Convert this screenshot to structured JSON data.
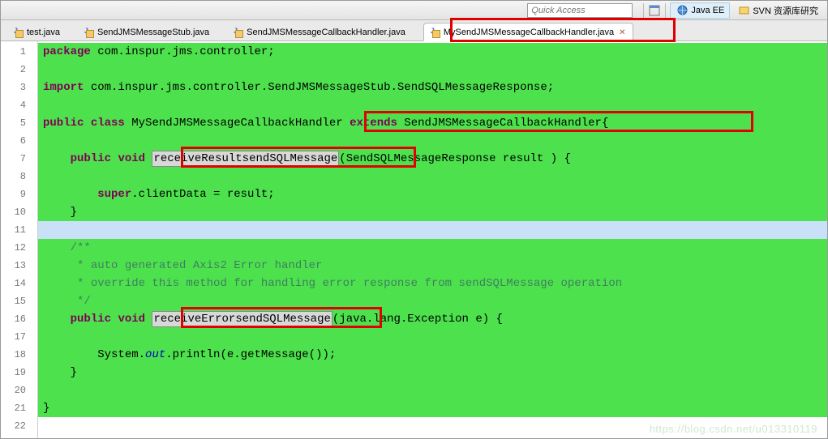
{
  "toolbar": {
    "quick_access_placeholder": "Quick Access",
    "perspectives": [
      {
        "label": "Java EE",
        "active": true
      },
      {
        "label": "SVN 资源库研究",
        "active": false
      }
    ]
  },
  "tabs": [
    {
      "label": "test.java",
      "active": false
    },
    {
      "label": "SendJMSMessageStub.java",
      "active": false
    },
    {
      "label": "SendJMSMessageCallbackHandler.java",
      "active": false
    },
    {
      "label": "MySendJMSMessageCallbackHandler.java",
      "active": true
    }
  ],
  "code_tokens": {
    "package": "package",
    "import": "import",
    "public": "public",
    "class": "class",
    "extends": "extends",
    "void": "void",
    "super": "super",
    "pkg_decl": " com.inspur.jms.controller;",
    "import_decl": " com.inspur.jms.controller.SendJMSMessageStub.SendSQLMessageResponse;",
    "class_name": " MySendJMSMessageCallbackHandler",
    "extends_name": " SendJMSMessageCallbackHandler{",
    "method1_name": "receiveResultsendSQLMessage",
    "method1_sig": "(SendSQLMessageResponse result ) {",
    "body1": ".clientData = result;",
    "cm1": "/**",
    "cm2": " * auto generated Axis2 Error handler",
    "cm3": " * override this method for handling error response from sendSQLMessage operation",
    "cm4": " */",
    "method2_name": "receiveErrorsendSQLMessage",
    "method2_sig": "(java.lang.Exception e) {",
    "out_field": "out",
    "body2a": "System.",
    "body2b": ".println(e.getMessage());",
    "brace_close": "}",
    "indent4": "    ",
    "indent8": "        ",
    "space": " ",
    "sp_extends": " extends"
  },
  "lines": [
    1,
    2,
    3,
    4,
    5,
    6,
    7,
    8,
    9,
    10,
    11,
    12,
    13,
    14,
    15,
    16,
    17,
    18,
    19,
    20,
    21,
    22
  ],
  "watermark": "https://blog.csdn.net/u013310119"
}
